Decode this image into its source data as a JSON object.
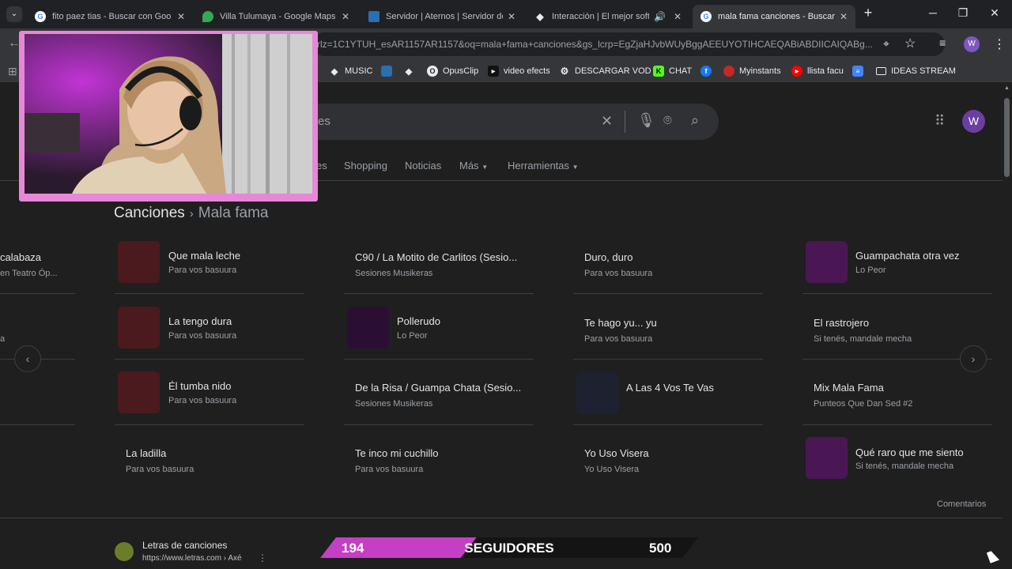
{
  "tabs": [
    {
      "label": "fito paez tias - Buscar con Goo",
      "icon": "google-icon",
      "active": false
    },
    {
      "label": "Villa Tulumaya - Google Maps",
      "icon": "maps-icon",
      "active": false
    },
    {
      "label": "Servidor | Aternos | Servidor de",
      "icon": "aternos-icon",
      "active": false
    },
    {
      "label": "Interacción | El mejor softw",
      "icon": "diamond-icon",
      "active": false
    },
    {
      "label": "mala fama canciones - Buscar",
      "icon": "google-icon",
      "active": true
    }
  ],
  "address": "rlz=1C1YTUH_esAR1157AR1157&oq=mala+fama+canciones&gs_lcrp=EgZjaHJvbWUyBggAEEUYOTIHCAEQABiABDIICAIQABg...",
  "profile_initial": "W",
  "bookmarks": [
    {
      "label": "MUSIC",
      "icon": "diamond-icon"
    },
    {
      "label": "",
      "icon": "aternos-icon"
    },
    {
      "label": "",
      "icon": "diamond-icon"
    },
    {
      "label": "OpusClip",
      "icon": "opusclip-icon"
    },
    {
      "label": "video efects",
      "icon": "video-icon"
    },
    {
      "label": "DESCARGAR VOD",
      "icon": "gear-icon"
    },
    {
      "label": "CHAT",
      "icon": "kick-icon"
    },
    {
      "label": "",
      "icon": "facebook-icon"
    },
    {
      "label": "Myinstants",
      "icon": "myinstants-icon"
    },
    {
      "label": "llista facu",
      "icon": "youtube-icon"
    },
    {
      "label": "",
      "icon": "docs-icon"
    },
    {
      "label": "IDEAS STREAM",
      "icon": "folder-icon"
    }
  ],
  "search": {
    "query_visible": "es"
  },
  "nav_tabs": {
    "partial": "es",
    "shopping": "Shopping",
    "noticias": "Noticias",
    "mas": "Más",
    "herramientas": "Herramientas"
  },
  "breadcrumb": {
    "root": "Canciones",
    "sub": "Mala fama"
  },
  "songs": [
    {
      "title": "calabaza",
      "artist": "en Teatro Óp...",
      "thumb": ""
    },
    {
      "title": "Que mala leche",
      "artist": "Para vos basuura",
      "thumb": "#4a1a1f"
    },
    {
      "title": "C90 / La Motito de Carlitos (Sesio...",
      "artist": "Sesiones Musikeras",
      "thumb": ""
    },
    {
      "title": "Duro, duro",
      "artist": "Para vos basuura",
      "thumb": ""
    },
    {
      "title": "Guampachata otra vez",
      "artist": "Lo Peor",
      "thumb": "#4a1654"
    },
    {
      "title": "",
      "artist": "a",
      "thumb": ""
    },
    {
      "title": "La tengo dura",
      "artist": "Para vos basuura",
      "thumb": "#4a1a1f"
    },
    {
      "title": "Pollerudo",
      "artist": "Lo Peor",
      "thumb": "#2a0f33"
    },
    {
      "title": "Te hago yu... yu",
      "artist": "Para vos basuura",
      "thumb": ""
    },
    {
      "title": "El rastrojero",
      "artist": "Si tenés, mandale mecha",
      "thumb": ""
    },
    {
      "title": "Él tumba nido",
      "artist": "Para vos basuura",
      "thumb": "#4a1a1f"
    },
    {
      "title": "De la Risa / Guampa Chata (Sesio...",
      "artist": "Sesiones Musikeras",
      "thumb": ""
    },
    {
      "title": "A Las 4 Vos Te Vas",
      "artist": "",
      "thumb": "#1e2230"
    },
    {
      "title": "Mix Mala Fama",
      "artist": "Punteos Que Dan Sed #2",
      "thumb": ""
    },
    {
      "title": "La ladilla",
      "artist": "Para vos basuura",
      "thumb": ""
    },
    {
      "title": "Te inco mi cuchillo",
      "artist": "Para vos basuura",
      "thumb": ""
    },
    {
      "title": "Yo Uso Visera",
      "artist": "Yo Uso Visera",
      "thumb": ""
    },
    {
      "title": "Qué raro que me siento",
      "artist": "Si tenés, mandale mecha",
      "thumb": "#4a1654"
    }
  ],
  "comentarios": "Comentarios",
  "result": {
    "title": "Letras de canciones",
    "url": "https://www.letras.com › Axé"
  },
  "followers": {
    "current": "194",
    "label": "SEGUIDORES",
    "goal": "500",
    "progress": 0.388
  }
}
